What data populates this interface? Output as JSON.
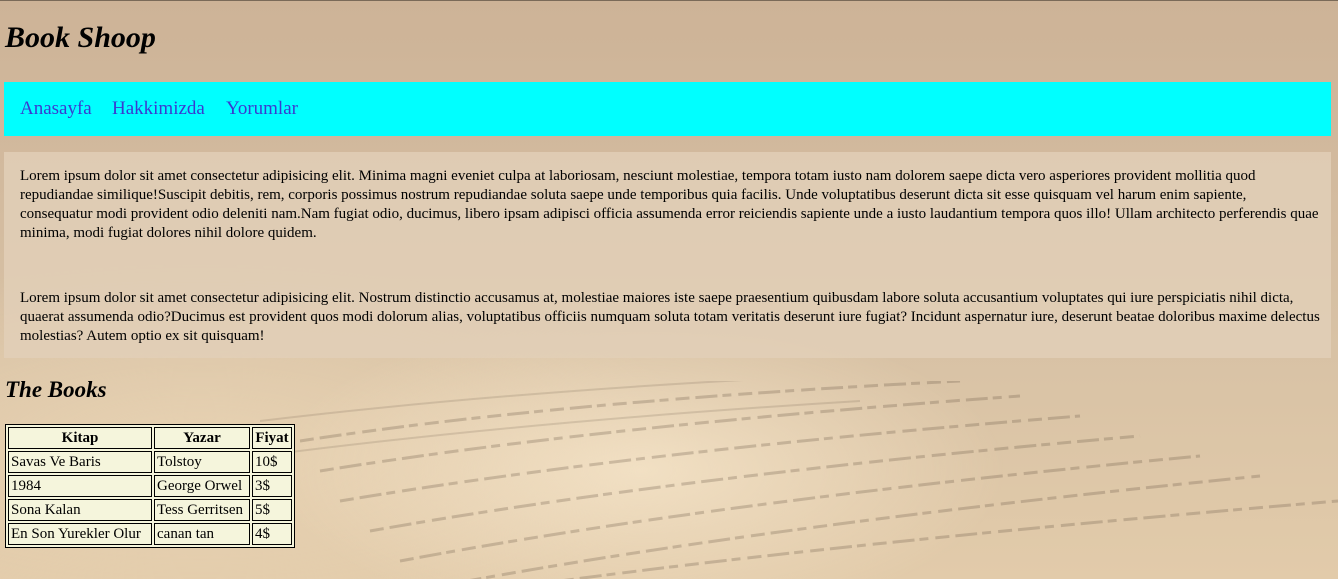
{
  "site": {
    "title": "Book Shoop"
  },
  "nav": {
    "items": [
      {
        "label": "Anasayfa"
      },
      {
        "label": "Hakkimizda"
      },
      {
        "label": "Yorumlar"
      }
    ]
  },
  "content": {
    "paragraphs": [
      "Lorem ipsum dolor sit amet consectetur adipisicing elit. Minima magni eveniet culpa at laboriosam, nesciunt molestiae, tempora totam iusto nam dolorem saepe dicta vero asperiores provident mollitia quod repudiandae similique!Suscipit debitis, rem, corporis possimus nostrum repudiandae soluta saepe unde temporibus quia facilis. Unde voluptatibus deserunt dicta sit esse quisquam vel harum enim sapiente, consequatur modi provident odio deleniti nam.Nam fugiat odio, ducimus, libero ipsam adipisci officia assumenda error reiciendis sapiente unde a iusto laudantium tempora quos illo! Ullam architecto perferendis quae minima, modi fugiat dolores nihil dolore quidem.",
      "Lorem ipsum dolor sit amet consectetur adipisicing elit. Nostrum distinctio accusamus at, molestiae maiores iste saepe praesentium quibusdam labore soluta accusantium voluptates qui iure perspiciatis nihil dicta, quaerat assumenda odio?Ducimus est provident quos modi dolorum alias, voluptatibus officiis numquam soluta totam veritatis deserunt iure fugiat? Incidunt aspernatur iure, deserunt beatae doloribus maxime delectus molestias? Autem optio ex sit quisquam!"
    ]
  },
  "books": {
    "heading": "The Books",
    "columns": [
      "Kitap",
      "Yazar",
      "Fiyat"
    ],
    "rows": [
      [
        "Savas Ve Baris",
        "Tolstoy",
        "10$"
      ],
      [
        "1984",
        "George Orwel",
        "3$"
      ],
      [
        "Sona Kalan",
        "Tess Gerritsen",
        "5$"
      ],
      [
        "En Son Yurekler Olur",
        "canan tan",
        "4$"
      ]
    ]
  },
  "colors": {
    "nav_background": "#00ffff",
    "nav_link": "#3a3ad0",
    "table_background": "#f5f5dc"
  }
}
